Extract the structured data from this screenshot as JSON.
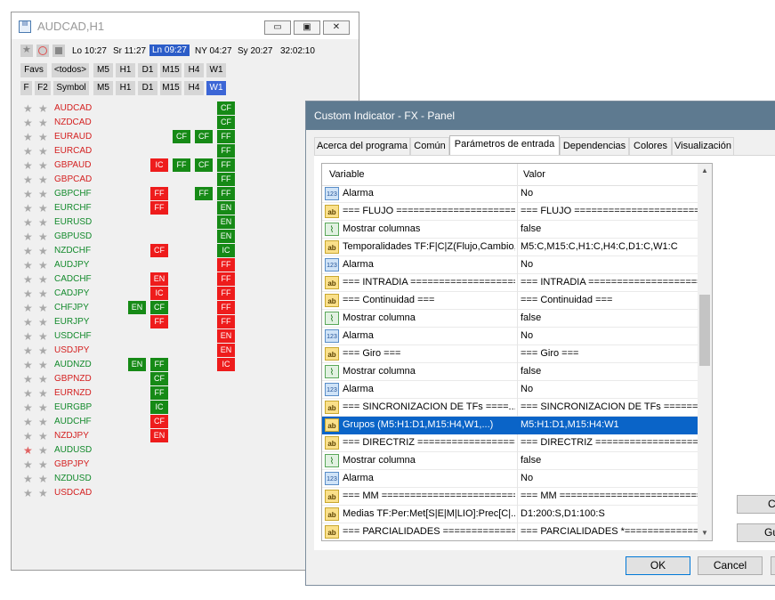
{
  "window1": {
    "title": "AUDCAD,H1",
    "toolbar": {
      "times": [
        "Lo 10:27",
        "Sr 11:27",
        "Ln 09:27",
        "NY 04:27",
        "Sy 20:27",
        "32:02:10"
      ],
      "highlighted": "Ln 09:27"
    },
    "row1_buttons": [
      "Favs",
      "<todos>",
      "M5",
      "H1",
      "D1",
      "M15",
      "H4",
      "W1"
    ],
    "row2_buttons": [
      "F",
      "F2",
      "Symbol",
      "M5",
      "H1",
      "D1",
      "M15",
      "H4",
      "W1"
    ],
    "row2_selected": "W1",
    "pairs": [
      {
        "symbol": "AUDCAD",
        "color": "red",
        "star": "gray",
        "cells": [
          {
            "col": 3,
            "text": "CF",
            "color": "g"
          }
        ]
      },
      {
        "symbol": "NZDCAD",
        "color": "red",
        "star": "gray",
        "cells": [
          {
            "col": 3,
            "text": "CF",
            "color": "g"
          }
        ]
      },
      {
        "symbol": "EURAUD",
        "color": "red",
        "star": "gray",
        "cells": [
          {
            "col": 1,
            "text": "CF",
            "color": "g"
          },
          {
            "col": 2,
            "text": "CF",
            "color": "g"
          },
          {
            "col": 3,
            "text": "FF",
            "color": "g"
          }
        ]
      },
      {
        "symbol": "EURCAD",
        "color": "red",
        "star": "gray",
        "cells": [
          {
            "col": 3,
            "text": "FF",
            "color": "g"
          }
        ]
      },
      {
        "symbol": "GBPAUD",
        "color": "red",
        "star": "gray",
        "cells": [
          {
            "col": 0,
            "text": "IC",
            "color": "r"
          },
          {
            "col": 1,
            "text": "FF",
            "color": "g"
          },
          {
            "col": 2,
            "text": "CF",
            "color": "g"
          },
          {
            "col": 3,
            "text": "FF",
            "color": "g"
          }
        ]
      },
      {
        "symbol": "GBPCAD",
        "color": "red",
        "star": "gray",
        "cells": [
          {
            "col": 3,
            "text": "FF",
            "color": "g"
          }
        ]
      },
      {
        "symbol": "GBPCHF",
        "color": "green",
        "star": "gray",
        "cells": [
          {
            "col": 0,
            "text": "FF",
            "color": "r"
          },
          {
            "col": 2,
            "text": "FF",
            "color": "g"
          },
          {
            "col": 3,
            "text": "FF",
            "color": "g"
          }
        ]
      },
      {
        "symbol": "EURCHF",
        "color": "green",
        "star": "gray",
        "cells": [
          {
            "col": 0,
            "text": "FF",
            "color": "r"
          },
          {
            "col": 3,
            "text": "EN",
            "color": "g"
          }
        ]
      },
      {
        "symbol": "EURUSD",
        "color": "green",
        "star": "gray",
        "cells": [
          {
            "col": 3,
            "text": "EN",
            "color": "g"
          }
        ]
      },
      {
        "symbol": "GBPUSD",
        "color": "green",
        "star": "gray",
        "cells": [
          {
            "col": 3,
            "text": "EN",
            "color": "g"
          }
        ]
      },
      {
        "symbol": "NZDCHF",
        "color": "green",
        "star": "gray",
        "cells": [
          {
            "col": 0,
            "text": "CF",
            "color": "r"
          },
          {
            "col": 3,
            "text": "IC",
            "color": "g"
          }
        ]
      },
      {
        "symbol": "AUDJPY",
        "color": "green",
        "star": "gray",
        "cells": [
          {
            "col": 3,
            "text": "FF",
            "color": "r"
          }
        ]
      },
      {
        "symbol": "CADCHF",
        "color": "green",
        "star": "gray",
        "cells": [
          {
            "col": 0,
            "text": "EN",
            "color": "r"
          },
          {
            "col": 3,
            "text": "FF",
            "color": "r"
          }
        ]
      },
      {
        "symbol": "CADJPY",
        "color": "green",
        "star": "gray",
        "cells": [
          {
            "col": 0,
            "text": "IC",
            "color": "r"
          },
          {
            "col": 3,
            "text": "FF",
            "color": "r"
          }
        ]
      },
      {
        "symbol": "CHFJPY",
        "color": "green",
        "star": "gray",
        "cells": [
          {
            "col": -1,
            "text": "EN",
            "color": "g"
          },
          {
            "col": 0,
            "text": "CF",
            "color": "g"
          },
          {
            "col": 3,
            "text": "FF",
            "color": "r"
          }
        ]
      },
      {
        "symbol": "EURJPY",
        "color": "green",
        "star": "gray",
        "cells": [
          {
            "col": 0,
            "text": "FF",
            "color": "r"
          },
          {
            "col": 3,
            "text": "FF",
            "color": "r"
          }
        ]
      },
      {
        "symbol": "USDCHF",
        "color": "green",
        "star": "gray",
        "cells": [
          {
            "col": 3,
            "text": "EN",
            "color": "r"
          }
        ]
      },
      {
        "symbol": "USDJPY",
        "color": "red",
        "star": "gray",
        "cells": [
          {
            "col": 3,
            "text": "EN",
            "color": "r"
          }
        ]
      },
      {
        "symbol": "AUDNZD",
        "color": "green",
        "star": "gray",
        "cells": [
          {
            "col": -1,
            "text": "EN",
            "color": "g"
          },
          {
            "col": 0,
            "text": "FF",
            "color": "g"
          },
          {
            "col": 3,
            "text": "IC",
            "color": "r"
          }
        ]
      },
      {
        "symbol": "GBPNZD",
        "color": "red",
        "star": "gray",
        "cells": [
          {
            "col": 0,
            "text": "CF",
            "color": "g"
          }
        ]
      },
      {
        "symbol": "EURNZD",
        "color": "red",
        "star": "gray",
        "cells": [
          {
            "col": 0,
            "text": "FF",
            "color": "g"
          }
        ]
      },
      {
        "symbol": "EURGBP",
        "color": "green",
        "star": "gray",
        "cells": [
          {
            "col": 0,
            "text": "IC",
            "color": "g"
          }
        ]
      },
      {
        "symbol": "AUDCHF",
        "color": "green",
        "star": "gray",
        "cells": [
          {
            "col": 0,
            "text": "CF",
            "color": "r"
          }
        ]
      },
      {
        "symbol": "NZDJPY",
        "color": "red",
        "star": "gray",
        "cells": [
          {
            "col": 0,
            "text": "EN",
            "color": "r"
          }
        ]
      },
      {
        "symbol": "AUDUSD",
        "color": "green",
        "star": "red",
        "cells": []
      },
      {
        "symbol": "GBPJPY",
        "color": "red",
        "star": "gray",
        "cells": []
      },
      {
        "symbol": "NZDUSD",
        "color": "green",
        "star": "gray",
        "cells": []
      },
      {
        "symbol": "USDCAD",
        "color": "red",
        "star": "gray",
        "cells": []
      }
    ]
  },
  "window2": {
    "title": "Custom Indicator - FX - Panel",
    "tabs": [
      "Acerca del programa",
      "Común",
      "Parámetros de entrada",
      "Dependencias",
      "Colores",
      "Visualización"
    ],
    "active_tab": "Parámetros de entrada",
    "grid_headers": {
      "variable": "Variable",
      "value": "Valor"
    },
    "rows": [
      {
        "icon": "123",
        "variable": "Alarma",
        "value": "No"
      },
      {
        "icon": "ab",
        "variable": "=== FLUJO ========================",
        "value": "=== FLUJO ============================"
      },
      {
        "icon": "chart",
        "variable": "Mostrar columnas",
        "value": "false"
      },
      {
        "icon": "ab",
        "variable": "Temporalidades TF:F|C|Z(Flujo,Cambio,...",
        "value": "M5:C,M15:C,H1:C,H4:C,D1:C,W1:C"
      },
      {
        "icon": "123",
        "variable": "Alarma",
        "value": "No"
      },
      {
        "icon": "ab",
        "variable": "=== INTRADIA =====================",
        "value": "=== INTRADIA =========================="
      },
      {
        "icon": "ab",
        "variable": "=== Continuidad ===",
        "value": "=== Continuidad ==="
      },
      {
        "icon": "chart",
        "variable": "Mostrar columna",
        "value": "false"
      },
      {
        "icon": "123",
        "variable": "Alarma",
        "value": "No"
      },
      {
        "icon": "ab",
        "variable": "=== Giro ===",
        "value": "=== Giro ==="
      },
      {
        "icon": "chart",
        "variable": "Mostrar columna",
        "value": "false"
      },
      {
        "icon": "123",
        "variable": "Alarma",
        "value": "No"
      },
      {
        "icon": "ab",
        "variable": "=== SINCRONIZACION DE TFs ====...",
        "value": "=== SINCRONIZACION DE TFs ========..."
      },
      {
        "icon": "ab",
        "variable": "Grupos (M5:H1:D1,M15:H4,W1,...)",
        "value": "M5:H1:D1,M15:H4:W1",
        "selected": true
      },
      {
        "icon": "ab",
        "variable": "=== DIRECTRIZ ====================",
        "value": "=== DIRECTRIZ ========================="
      },
      {
        "icon": "chart",
        "variable": "Mostrar columna",
        "value": "false"
      },
      {
        "icon": "123",
        "variable": "Alarma",
        "value": "No"
      },
      {
        "icon": "ab",
        "variable": "=== MM =========================",
        "value": "=== MM ==============================="
      },
      {
        "icon": "ab",
        "variable": "Medias TF:Per:Met[S|E|M|LIO]:Prec[C|...",
        "value": "D1:200:S,D1:100:S"
      },
      {
        "icon": "ab",
        "variable": "=== PARCIALIDADES =============",
        "value": "=== PARCIALIDADES *================="
      }
    ],
    "side_buttons": [
      "Ca",
      "Gu"
    ],
    "ok_label": "OK",
    "cancel_label": "Cancel"
  }
}
